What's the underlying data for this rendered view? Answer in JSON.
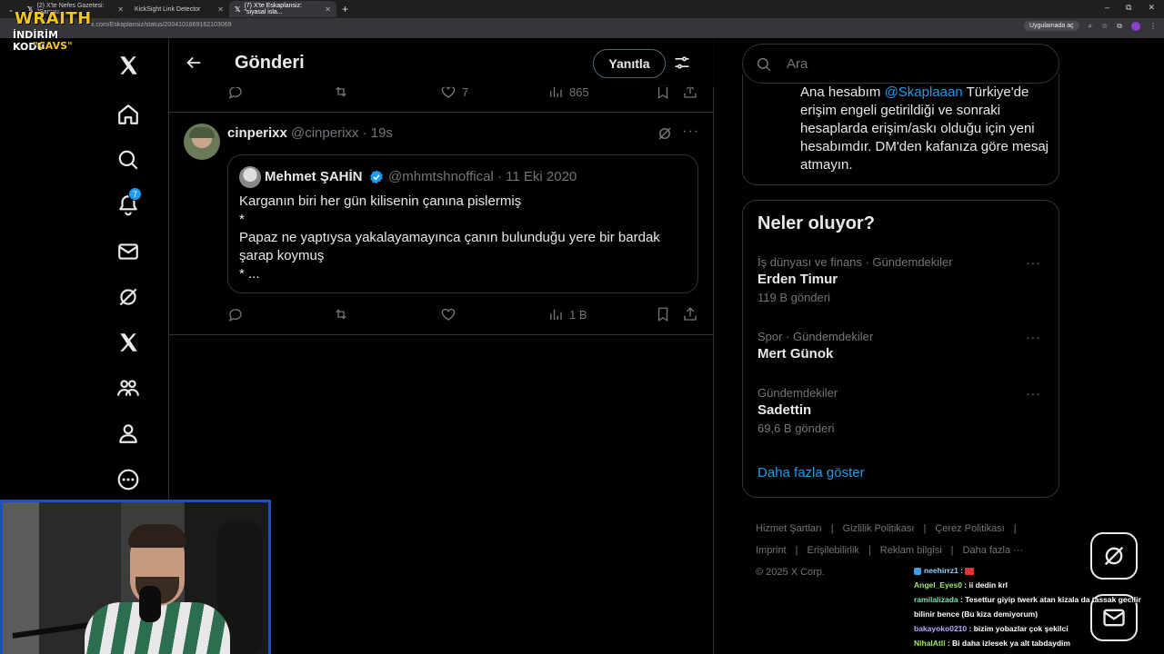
{
  "browser": {
    "tabs": [
      {
        "label": "(2) X'te Nefes Gazetesi: \"Samsu...",
        "close": "✕",
        "active": false
      },
      {
        "label": "KickSight Link Detector",
        "close": "✕",
        "active": false
      },
      {
        "label": "(7) X'te Eskaplansiz: \"siyasal isla...",
        "close": "✕",
        "active": true
      }
    ],
    "new_tab": "+",
    "url": "x.com/Eskaplansiz/status/2004101869162103069",
    "app_button": "Uygulamada aç",
    "window_controls": [
      "–",
      "⧉",
      "✕"
    ]
  },
  "overlay": {
    "logo_line1": "WRAITH",
    "logo_line2": "İNDİRİM KODU",
    "logo_line3": "\"CAVS\""
  },
  "nav": {
    "notifications_badge": "7",
    "icons": [
      "x-logo-icon",
      "home-icon",
      "search-icon",
      "notifications-icon",
      "messages-icon",
      "grok-icon",
      "premium-x-icon",
      "communities-icon",
      "profile-icon",
      "more-icon"
    ]
  },
  "header": {
    "title": "Gönderi",
    "reply_button": "Yanıtla"
  },
  "prev_tweet_actions": {
    "likes": "7",
    "views": "865"
  },
  "tweet": {
    "display_name": "cinperixx",
    "handle_time": "@cinperixx · 19s",
    "more": "···",
    "quote": {
      "display_name": "Mehmet ŞAHİN",
      "handle_date": "@mhmtshnoffical · 11 Eki 2020",
      "text": "Karganın biri her gün kilisenin çanına pislermiş\n*\nPapaz ne yaptıysa yakalayamayınca çanın bulunduğu yere bir bardak şarap koymuş\n* ..."
    },
    "views": "1 B"
  },
  "right": {
    "search_placeholder": "Ara",
    "bio_prefix": "Ana hesabım ",
    "bio_mention": "@Skaplaaan",
    "bio_rest": " Türkiye'de erişim engeli getirildiği ve sonraki hesaplarda erişim/askı olduğu için yeni hesabımdır. DM'den kafanıza göre mesaj atmayın.",
    "trends_title": "Neler oluyor?",
    "trends": [
      {
        "category": "İş dünyası ve finans · Gündemdekiler",
        "name": "Erden Timur",
        "count": "119 B gönderi"
      },
      {
        "category": "Spor · Gündemdekiler",
        "name": "Mert Günok",
        "count": ""
      },
      {
        "category": "Gündemdekiler",
        "name": "Sadettin",
        "count": "69,6 B gönderi"
      }
    ],
    "trend_more": "···",
    "show_more": "Daha fazla göster",
    "footer_links": [
      "Hizmet Şartları",
      "Gizlilik Politikası",
      "Çerez Politikası",
      "Imprint",
      "Erişilebilirlik",
      "Reklam bilgisi",
      "Daha fazla ···"
    ],
    "footer_sep": "|",
    "copyright": "© 2025 X Corp."
  },
  "chat": [
    {
      "user": "neehirrz1",
      "text": ""
    },
    {
      "user": "Angel_Eyes0",
      "text": "ii dedin krl"
    },
    {
      "user": "ramilalizada",
      "text": "Tesettur giyip twerk atan kizala da tassak gecilir"
    },
    {
      "user": "",
      "text": "bilinir bence (Bu kiza demiyorum)"
    },
    {
      "user": "bakayoko0210",
      "text": "bizim yobazlar çok şekilci"
    },
    {
      "user": "NihalAtli",
      "text": "Bi daha izlesek ya alt tabdaydim"
    }
  ],
  "chat_sep": " : "
}
